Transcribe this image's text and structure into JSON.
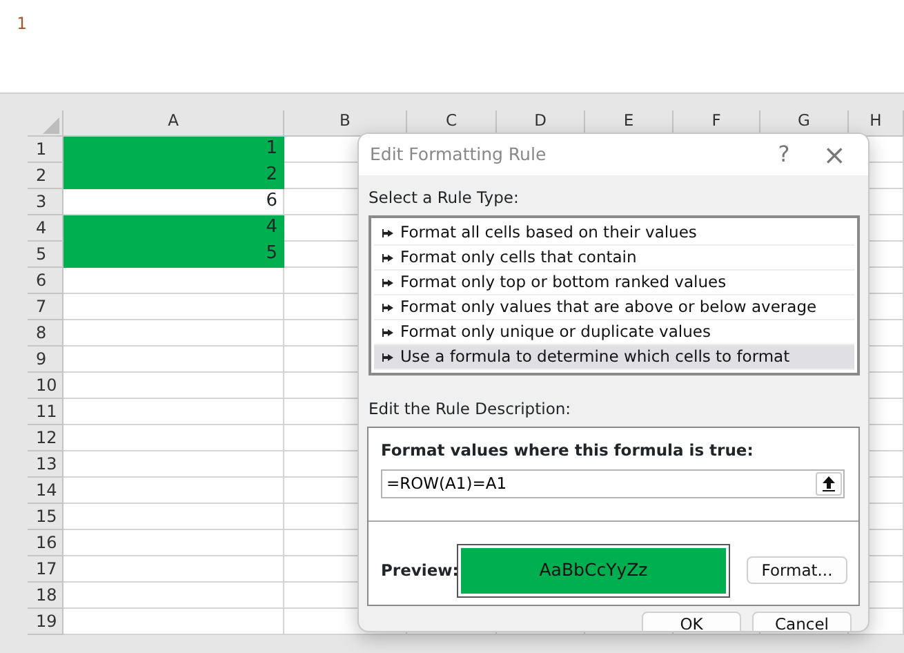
{
  "editor": {
    "line_numbers": [
      "1"
    ]
  },
  "sheet": {
    "columns": [
      "A",
      "B",
      "C",
      "D",
      "E",
      "F",
      "G",
      "H"
    ],
    "rows": [
      {
        "header": "1",
        "value": "1",
        "highlighted": true
      },
      {
        "header": "2",
        "value": "2",
        "highlighted": true
      },
      {
        "header": "3",
        "value": "6",
        "highlighted": false
      },
      {
        "header": "4",
        "value": "4",
        "highlighted": true
      },
      {
        "header": "5",
        "value": "5",
        "highlighted": true
      },
      {
        "header": "6"
      },
      {
        "header": "7"
      },
      {
        "header": "8"
      },
      {
        "header": "9"
      },
      {
        "header": "10"
      },
      {
        "header": "11"
      },
      {
        "header": "12"
      },
      {
        "header": "13"
      },
      {
        "header": "14"
      },
      {
        "header": "15"
      },
      {
        "header": "16"
      },
      {
        "header": "17"
      },
      {
        "header": "18"
      },
      {
        "header": "19"
      }
    ]
  },
  "dialog": {
    "title": "Edit Formatting Rule",
    "help": "?",
    "close": "×",
    "rule_type_label": "Select a Rule Type:",
    "rule_types": [
      {
        "label": "Format all cells based on their values",
        "selected": false
      },
      {
        "label": "Format only cells that contain",
        "selected": false
      },
      {
        "label": "Format only top or bottom ranked values",
        "selected": false
      },
      {
        "label": "Format only values that are above or below average",
        "selected": false
      },
      {
        "label": "Format only unique or duplicate values",
        "selected": false
      },
      {
        "label": "Use a formula to determine which cells to format",
        "selected": true
      }
    ],
    "description_label": "Edit the Rule Description:",
    "formula_label": "Format values where this formula is true:",
    "formula": "=ROW(A1)=A1",
    "preview_label": "Preview:",
    "preview": {
      "text": "AaBbCcYyZz",
      "color": "#00b050"
    },
    "format_button": "Format...",
    "buttons": [
      "OK",
      "Cancel"
    ]
  }
}
